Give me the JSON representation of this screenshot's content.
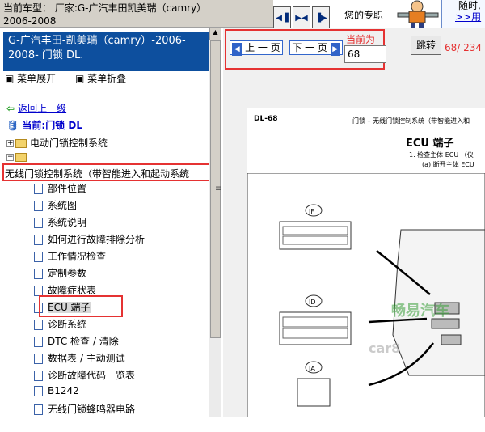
{
  "topbar": {
    "line1": "当前车型： 厂家:G-广汽丰田凯美瑞（camry）",
    "line2": "2006-2008"
  },
  "toolbar": {
    "icons": [
      "prev-page-icon",
      "next-page-icon",
      "split-icon"
    ],
    "pro_text": "您的专职",
    "promo_line1": "随时,",
    "promo_link": ">>用"
  },
  "sidebar": {
    "model_title": "G-广汽丰田-凯美瑞（camry）-2006-2008- 门锁 DL.",
    "expand_label": "菜单展开",
    "collapse_label": "菜单折叠",
    "back_label": "返回上一级",
    "current_label": "当前:门锁 DL",
    "tree": {
      "folder1": "电动门锁控制系统",
      "folder2_selected": "无线门锁控制系统（带智能进入和起动系统",
      "items": [
        "部件位置",
        "系统图",
        "系统说明",
        "如何进行故障排除分析",
        "工作情况检查",
        "定制参数",
        "故障症状表",
        "ECU 端子",
        "诊断系统",
        "DTC 检查 / 清除",
        "数据表 / 主动测试",
        "诊断故障代码一览表",
        "B1242",
        "无线门锁蜂鸣器电路"
      ]
    }
  },
  "viewer": {
    "prev_label": "上 一 页",
    "next_label": "下 一 页",
    "current_label": "当前为",
    "page_value": "68",
    "jump_label": "跳转",
    "page_count": "68/ 234",
    "doc": {
      "page_code": "DL-68",
      "header_right": "门锁 – 无线门锁控制系统（带智能进入和",
      "section_title": "ECU 端子",
      "step1": "1.    检查主体 ECU （仪",
      "step1a": "(a)  断开主体 ECU",
      "connectors": [
        "IF",
        "ID",
        "IA"
      ],
      "watermark1": "畅易汽车",
      "watermark2": "car8"
    }
  },
  "colors": {
    "highlight_red": "#e53232",
    "model_bg": "#0d4f9e",
    "link_blue": "#0000cc"
  }
}
